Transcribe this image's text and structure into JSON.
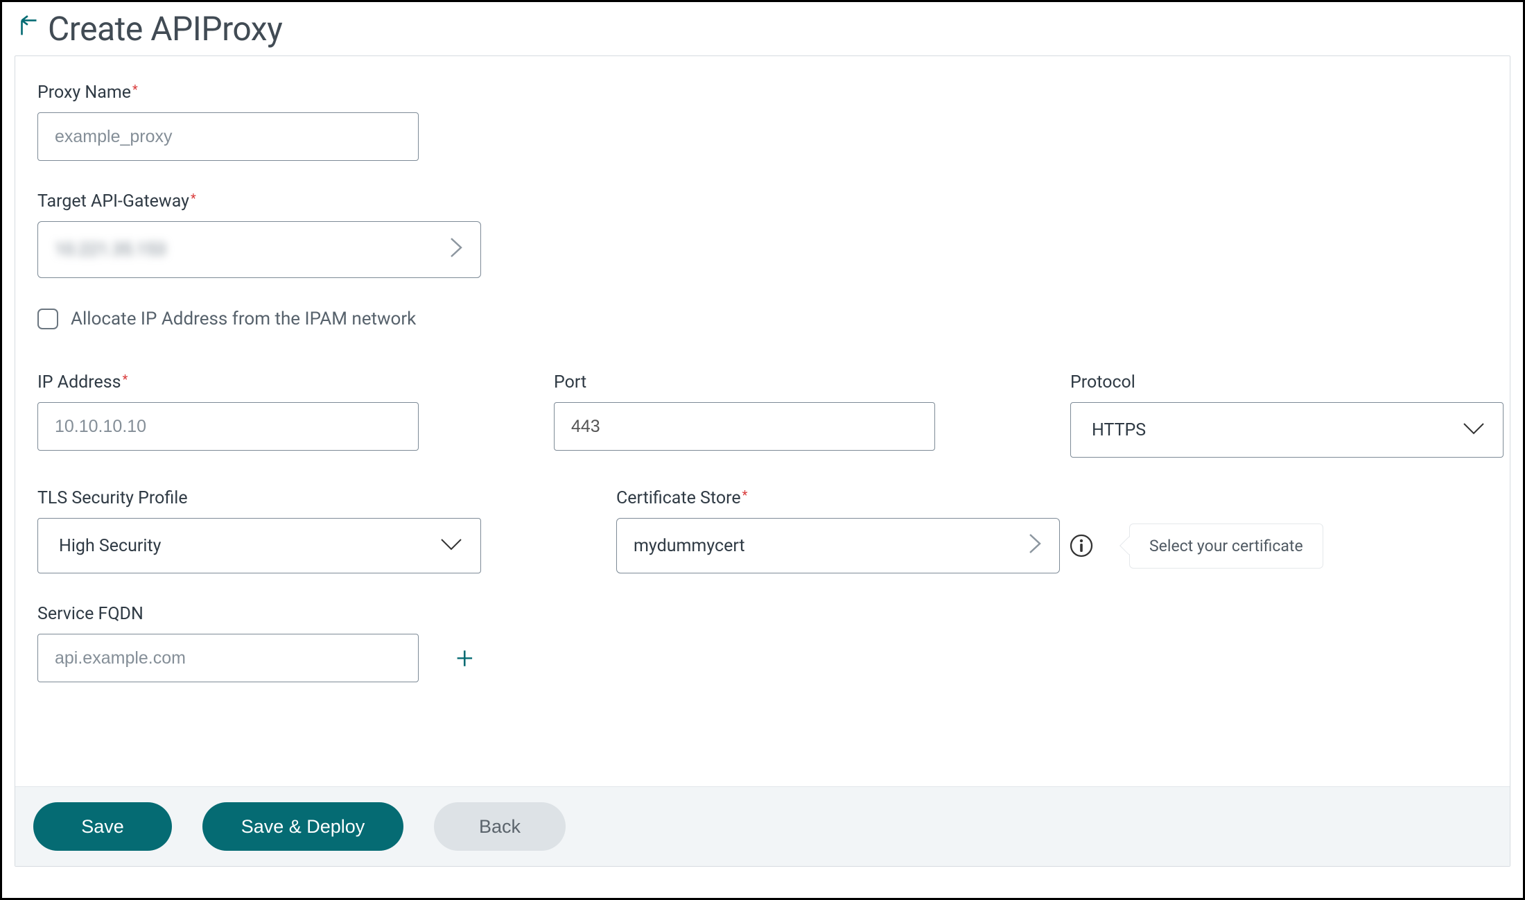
{
  "header": {
    "title": "Create APIProxy"
  },
  "form": {
    "proxy_name": {
      "label": "Proxy Name",
      "required": true,
      "placeholder": "example_proxy",
      "value": ""
    },
    "target_gateway": {
      "label": "Target API-Gateway",
      "required": true,
      "value": "10.221.35.153"
    },
    "allocate_ipam": {
      "label": "Allocate IP Address from the IPAM network",
      "checked": false
    },
    "ip_address": {
      "label": "IP Address",
      "required": true,
      "placeholder": "10.10.10.10",
      "value": ""
    },
    "port": {
      "label": "Port",
      "value": "443"
    },
    "protocol": {
      "label": "Protocol",
      "value": "HTTPS"
    },
    "tls_profile": {
      "label": "TLS Security Profile",
      "value": "High Security"
    },
    "cert_store": {
      "label": "Certificate Store",
      "required": true,
      "value": "mydummycert",
      "hint": "Select your certificate"
    },
    "service_fqdn": {
      "label": "Service FQDN",
      "placeholder": "api.example.com",
      "value": ""
    }
  },
  "footer": {
    "save": "Save",
    "save_deploy": "Save & Deploy",
    "back": "Back"
  }
}
